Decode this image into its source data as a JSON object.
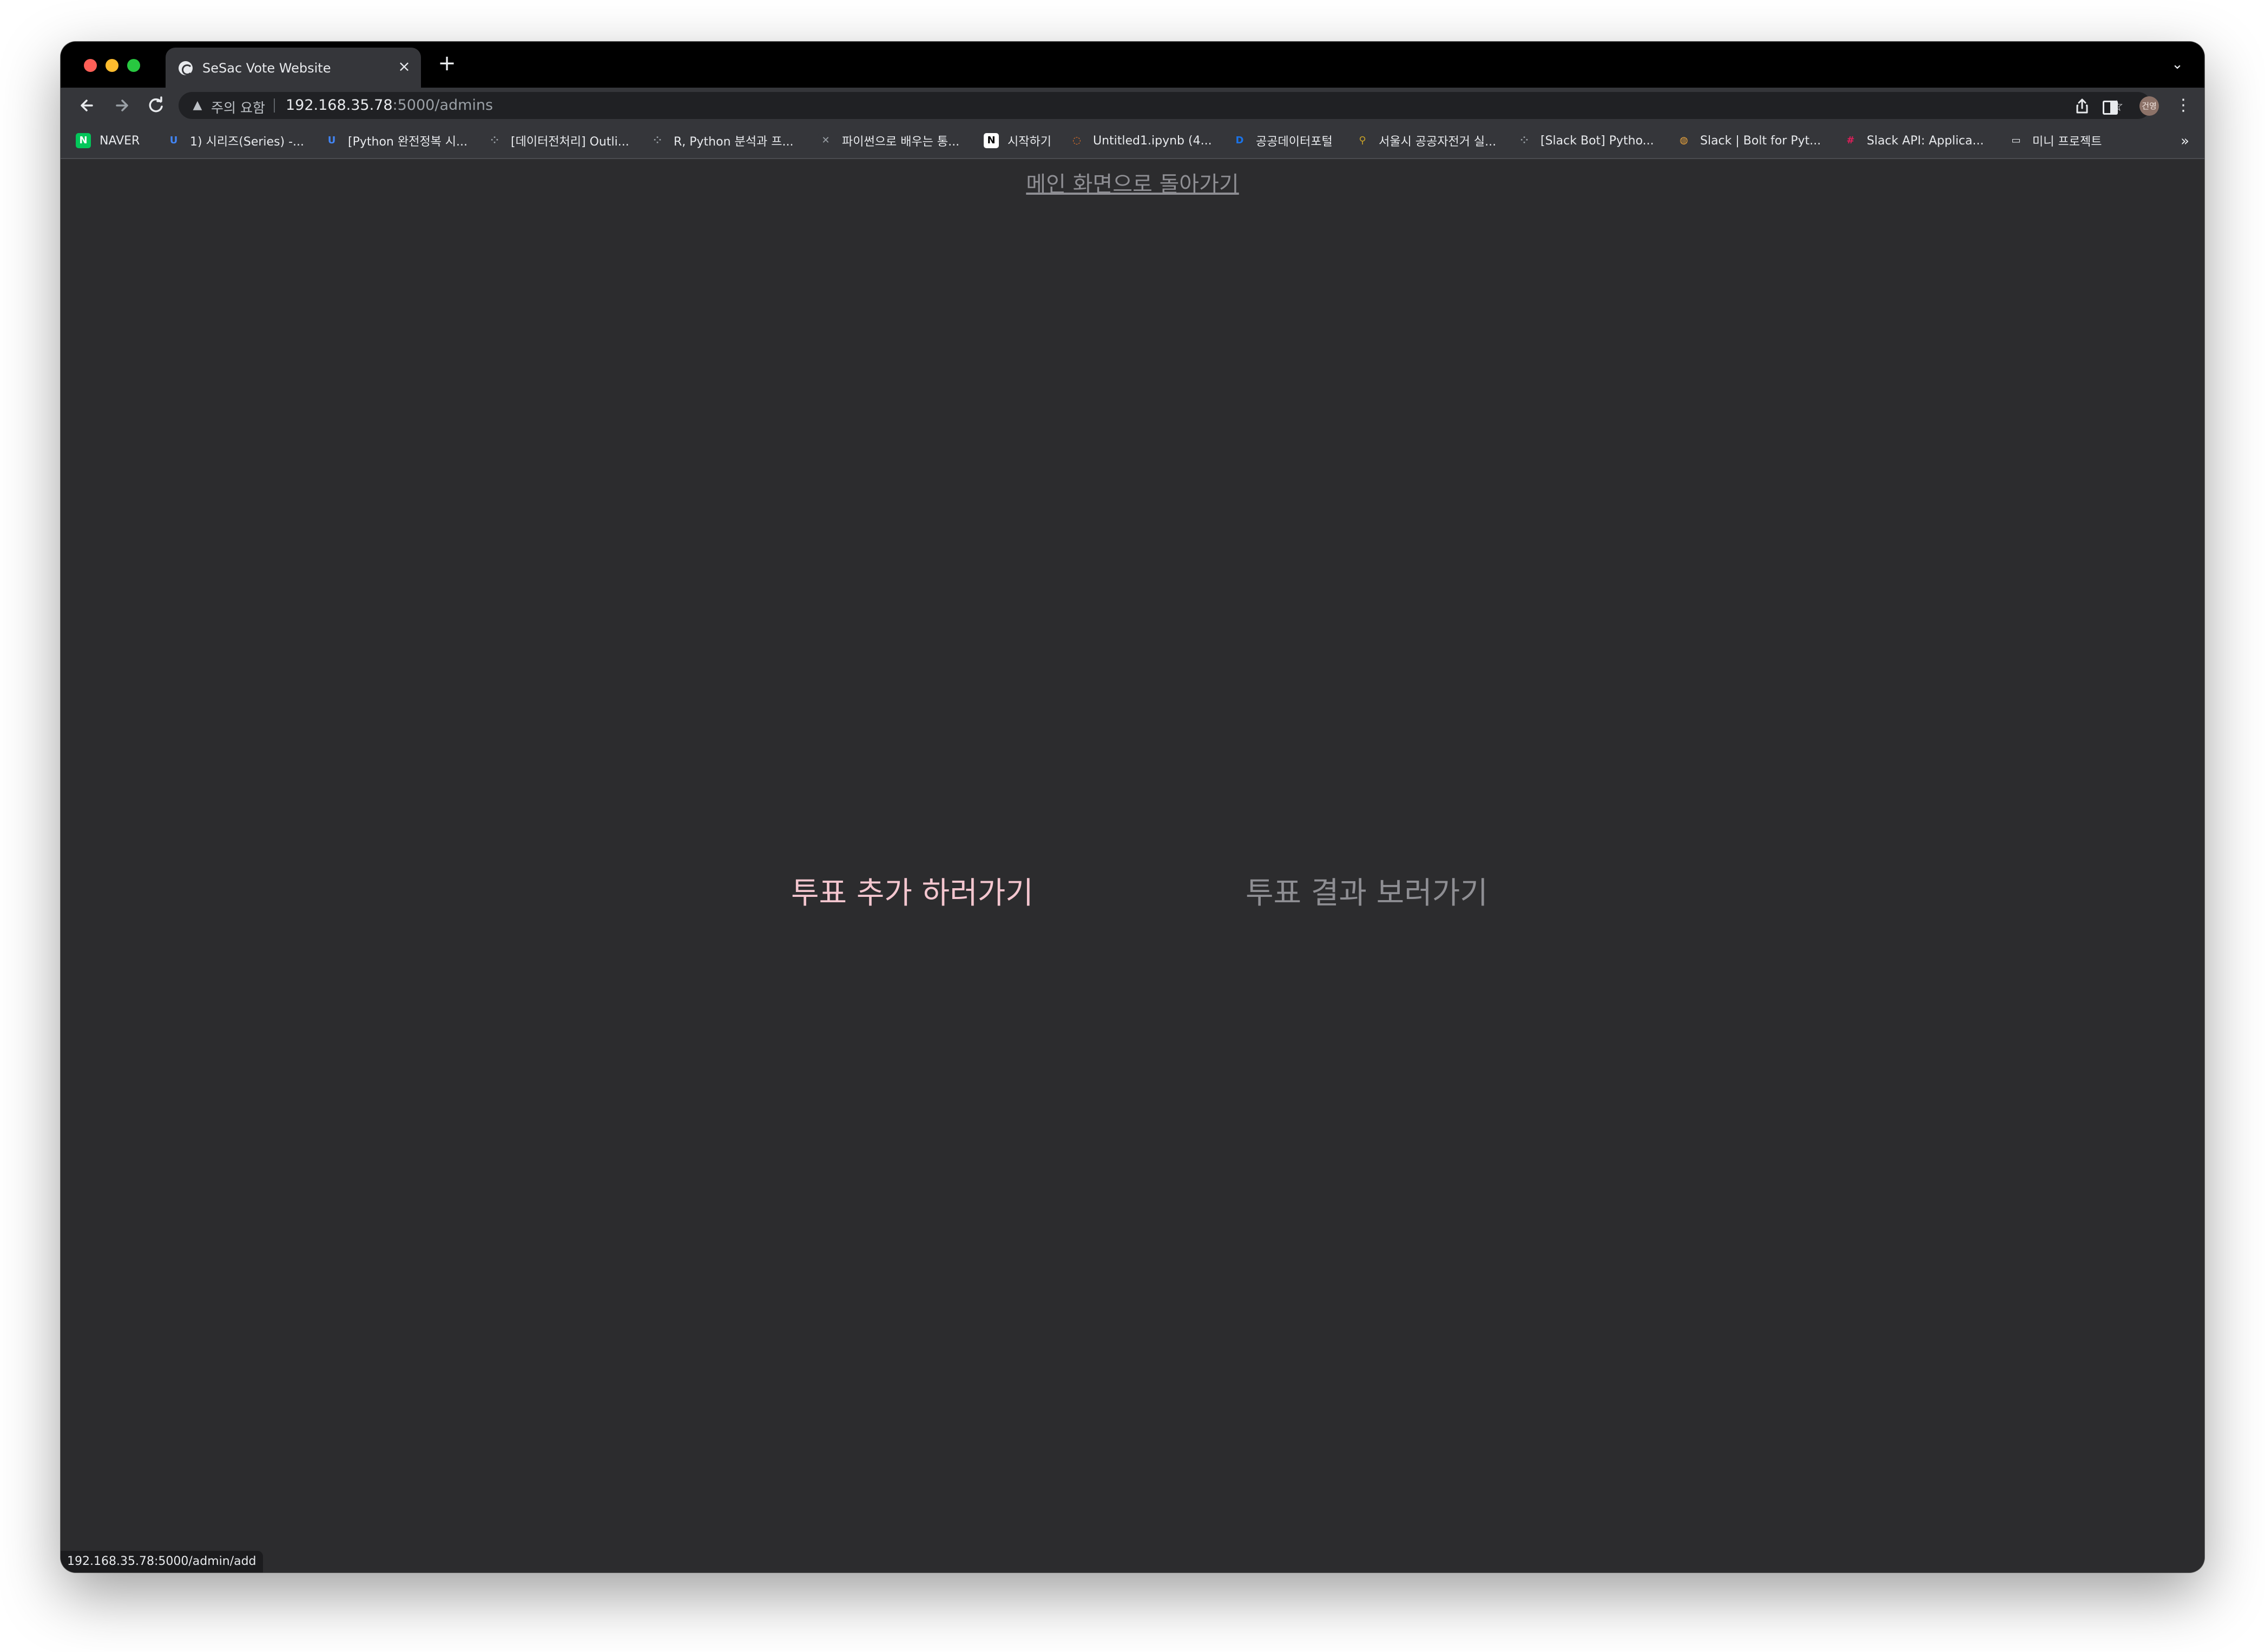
{
  "browser": {
    "tab_title": "SeSac Vote Website",
    "tab_close": "×",
    "new_tab": "+",
    "tab_search": "⌄",
    "security_label": "주의 요함",
    "url_host": "192.168.35.78",
    "url_rest": ":5000/admins",
    "avatar_text": "건영",
    "status_url": "192.168.35.78:5000/admin/add"
  },
  "icons": {
    "back": "arrow-left-icon",
    "forward": "arrow-right-icon",
    "reload": "reload-icon",
    "warning": "warning-icon",
    "share": "share-icon",
    "star": "star-icon",
    "side_panel": "side-panel-icon",
    "menu": "kebab-menu-icon"
  },
  "bookmarks": [
    {
      "label": "NAVER",
      "icon": "naver-icon",
      "glyph": "N",
      "color": "#03c75a",
      "fg": "#ffffff"
    },
    {
      "label": "1) 시리즈(Series) -...",
      "icon": "velog-icon",
      "glyph": "U",
      "color": "#35363a",
      "fg": "#4285f4"
    },
    {
      "label": "[Python 완전정복 시...",
      "icon": "velog-icon",
      "glyph": "U",
      "color": "#35363a",
      "fg": "#4285f4"
    },
    {
      "label": "[데이터전처리] Outli...",
      "icon": "tistory-icon",
      "glyph": "⁘",
      "color": "#35363a",
      "fg": "#9aa0a6"
    },
    {
      "label": "R, Python 분석과 프...",
      "icon": "tistory-icon",
      "glyph": "⁘",
      "color": "#35363a",
      "fg": "#9aa0a6"
    },
    {
      "label": "파이썬으로 배우는 통...",
      "icon": "book-icon",
      "glyph": "✕",
      "color": "#35363a",
      "fg": "#9aa0a6"
    },
    {
      "label": "시작하기",
      "icon": "notion-icon",
      "glyph": "N",
      "color": "#ffffff",
      "fg": "#000000"
    },
    {
      "label": "Untitled1.ipynb (4...",
      "icon": "jupyter-icon",
      "glyph": "◌",
      "color": "#35363a",
      "fg": "#f37626"
    },
    {
      "label": "공공데이터포털",
      "icon": "data-portal-icon",
      "glyph": "D",
      "color": "#35363a",
      "fg": "#1a73e8"
    },
    {
      "label": "서울시 공공자전거 실...",
      "icon": "bike-icon",
      "glyph": "⚲",
      "color": "#35363a",
      "fg": "#c9a227"
    },
    {
      "label": "[Slack Bot] Pytho...",
      "icon": "tistory-icon",
      "glyph": "⁘",
      "color": "#35363a",
      "fg": "#9aa0a6"
    },
    {
      "label": "Slack | Bolt for Pyt...",
      "icon": "bolt-icon",
      "glyph": "◍",
      "color": "#35363a",
      "fg": "#e8a33d"
    },
    {
      "label": "Slack API: Applica...",
      "icon": "slack-icon",
      "glyph": "#",
      "color": "#35363a",
      "fg": "#e01e5a"
    },
    {
      "label": "미니 프로젝트",
      "icon": "folder-icon",
      "glyph": "▭",
      "color": "#35363a",
      "fg": "#e8eaed"
    }
  ],
  "bookmarks_overflow": "»",
  "page": {
    "back_link": "메인 화면으로 돌아가기",
    "add_vote_link": "투표 추가 하러가기",
    "results_link": "투표 결과 보러가기"
  },
  "colors": {
    "page_background": "#2c2c2e",
    "add_link": "#f4c6cf",
    "muted_link": "#8e8e93"
  }
}
